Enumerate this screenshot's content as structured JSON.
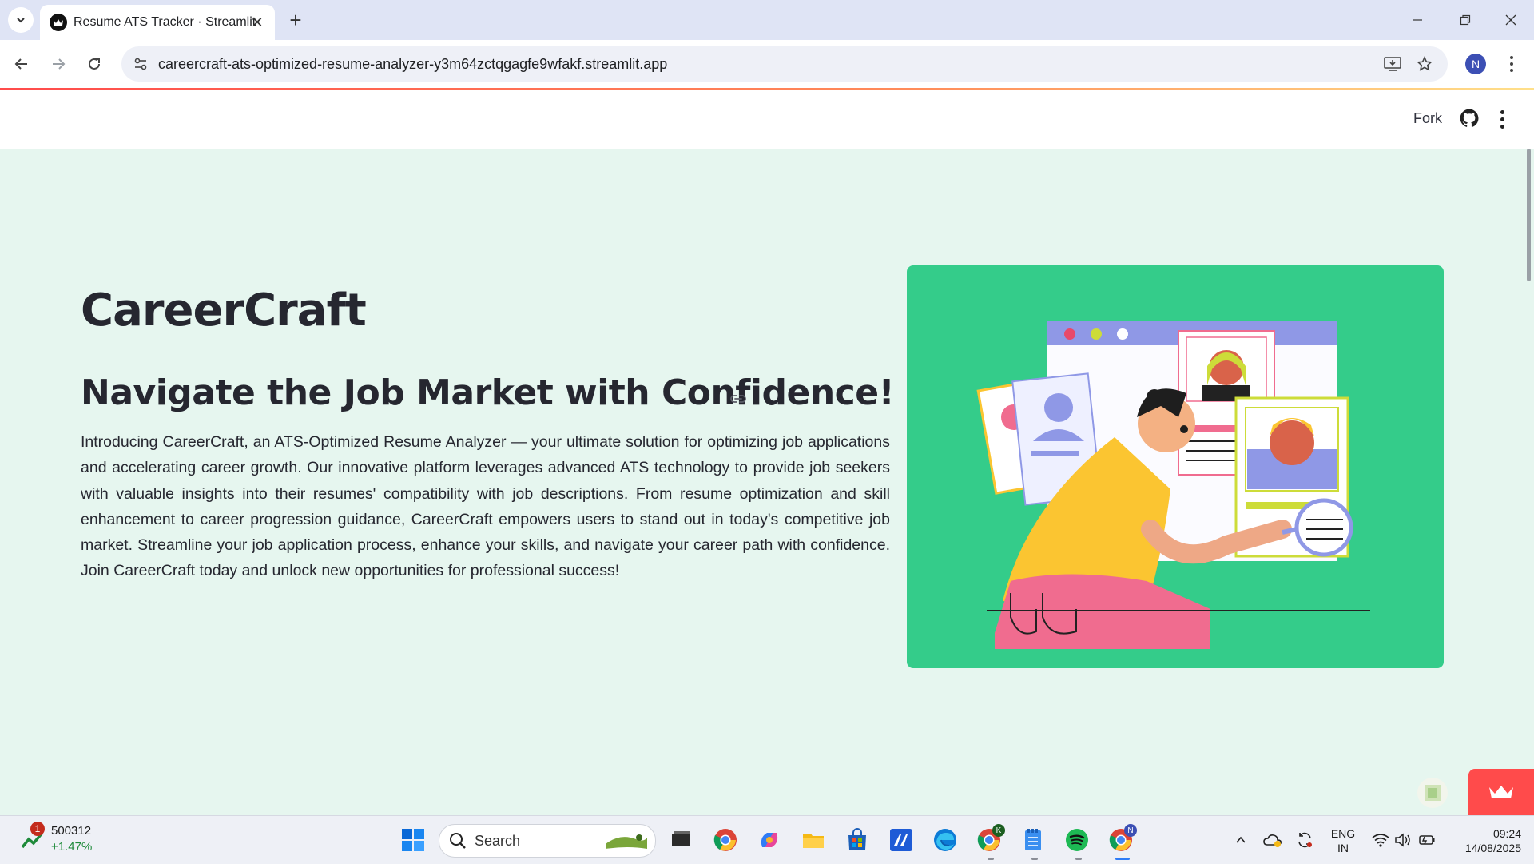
{
  "browser": {
    "tab_title": "Resume ATS Tracker · Streamlit",
    "url": "careercraft-ats-optimized-resume-analyzer-y3m64zctqgagfe9wfakf.streamlit.app",
    "profile_initial": "N"
  },
  "header": {
    "fork_label": "Fork"
  },
  "main": {
    "title": "CareerCraft",
    "subtitle": "Navigate the Job Market with Confidence!",
    "intro": "Introducing CareerCraft, an ATS-Optimized Resume Analyzer — your ultimate solution for optimizing job applications and accelerating career growth. Our innovative platform leverages advanced ATS technology to provide job seekers with valuable insights into their resumes' compatibility with job descriptions. From resume optimization and skill enhancement to career progression guidance, CareerCraft empowers users to stand out in today's competitive job market. Streamline your job application process, enhance your skills, and navigate your career path with confidence. Join CareerCraft today and unlock new opportunities for professional success!"
  },
  "taskbar": {
    "stock_badge": "1",
    "stock_value": "500312",
    "stock_change": "+1.47%",
    "search_label": "Search",
    "chrome_profile_k": "K",
    "chrome_profile_n": "N",
    "lang_top": "ENG",
    "lang_bottom": "IN",
    "time": "09:24",
    "date": "14/08/2025"
  },
  "colors": {
    "page_bg": "#e6f6ef",
    "illustration_bg": "#34cc8a",
    "streamlit_red": "#ff4b4b",
    "tab_strip": "#dfe4f5"
  },
  "icons": [
    "chevron-down-icon",
    "streamlit-crown-icon",
    "close-icon",
    "plus-icon",
    "minimize-icon",
    "restore-icon",
    "back-icon",
    "forward-icon",
    "reload-icon",
    "site-info-icon",
    "install-icon",
    "star-icon",
    "github-icon",
    "link-icon",
    "windows-start-icon",
    "search-icon",
    "chrome-icon",
    "copilot-icon",
    "folder-icon",
    "store-icon",
    "editor-icon",
    "edge-icon",
    "notepad-icon",
    "spotify-icon",
    "wifi-icon",
    "volume-icon",
    "battery-icon"
  ]
}
